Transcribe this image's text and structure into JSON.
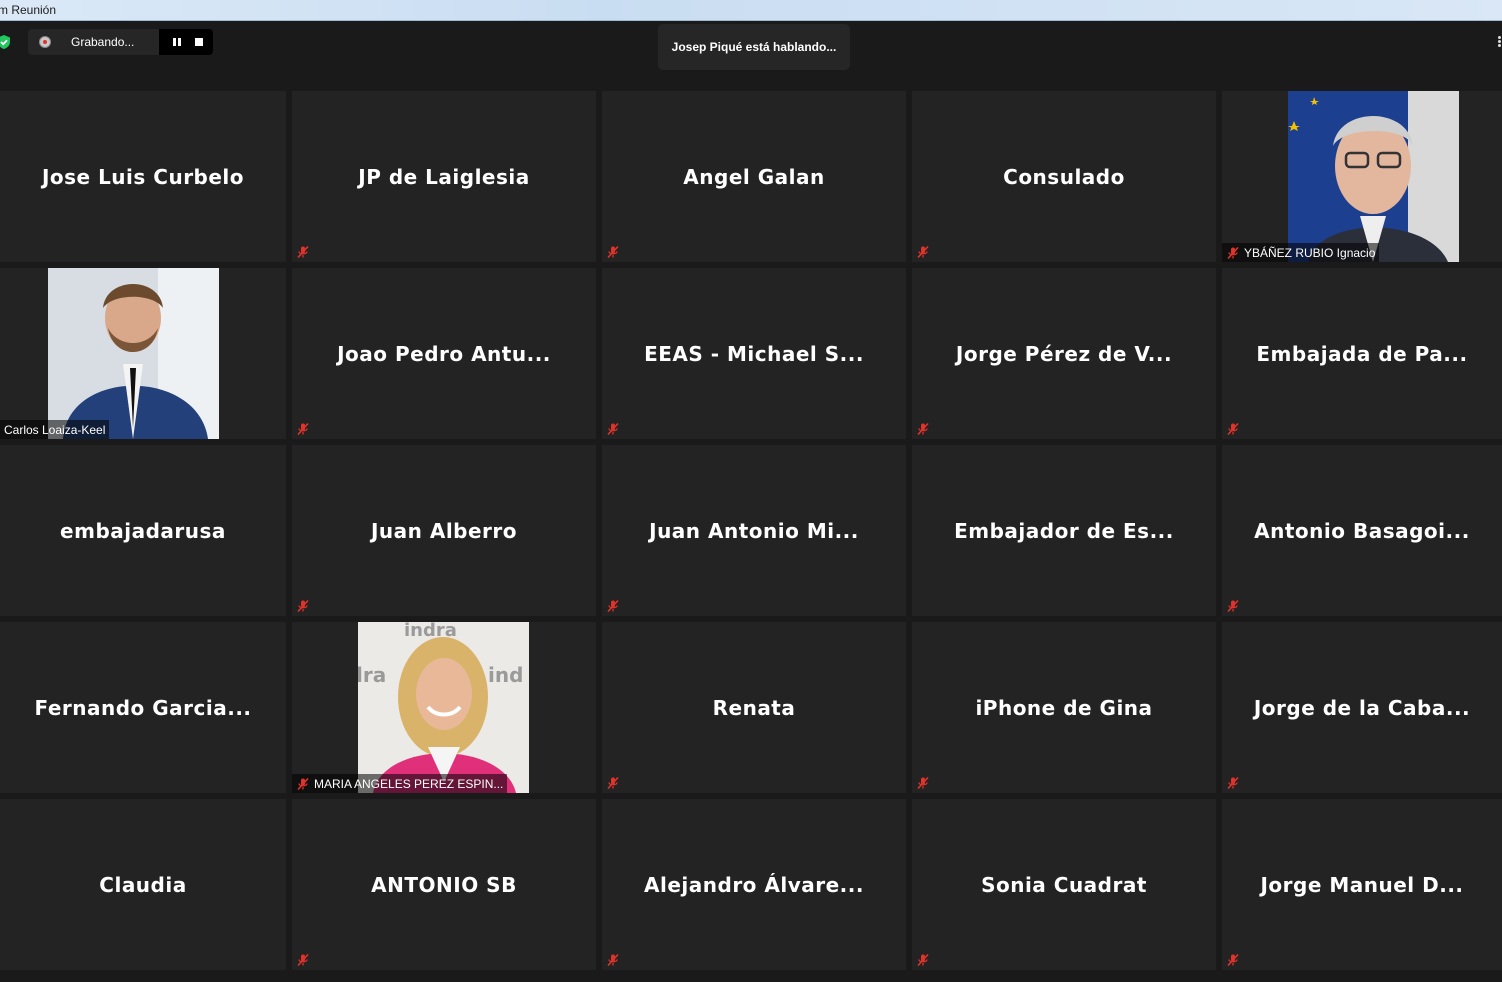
{
  "window": {
    "title": "m Reunión"
  },
  "recording": {
    "label": "Grabando..."
  },
  "speaking_banner": "Josep Piqué está hablando...",
  "participants": [
    {
      "name": "Jose Luis Curbelo",
      "muted": false
    },
    {
      "name": "JP de Laiglesia",
      "muted": true
    },
    {
      "name": "Angel Galan",
      "muted": true
    },
    {
      "name": "Consulado",
      "muted": true
    },
    {
      "name": "YBÁÑEZ RUBIO Ignacio",
      "muted": true,
      "video": true
    },
    {
      "name": "Carlos Loaiza-Keel",
      "muted": false,
      "video": true
    },
    {
      "name": "Joao Pedro Antu...",
      "muted": true
    },
    {
      "name": "EEAS - Michael S...",
      "muted": true
    },
    {
      "name": "Jorge Pérez de V...",
      "muted": true
    },
    {
      "name": "Embajada de Pa...",
      "muted": true
    },
    {
      "name": "embajadarusa",
      "muted": false
    },
    {
      "name": "Juan Alberro",
      "muted": true
    },
    {
      "name": "Juan Antonio Mi...",
      "muted": true
    },
    {
      "name": "Embajador de Es...",
      "muted": false
    },
    {
      "name": "Antonio Basagoi...",
      "muted": true
    },
    {
      "name": "Fernando Garcia...",
      "muted": false
    },
    {
      "name": "MARIA ANGELES PEREZ ESPIN...",
      "muted": true,
      "video": true
    },
    {
      "name": "Renata",
      "muted": true
    },
    {
      "name": "iPhone de Gina",
      "muted": true
    },
    {
      "name": "Jorge de la Caba...",
      "muted": true
    },
    {
      "name": "Claudia",
      "muted": false
    },
    {
      "name": "ANTONIO SB",
      "muted": true
    },
    {
      "name": "Alejandro Álvare...",
      "muted": true
    },
    {
      "name": "Sonia Cuadrat",
      "muted": true
    },
    {
      "name": "Jorge Manuel D...",
      "muted": true
    }
  ],
  "photo_logo_text": {
    "top": "indra",
    "left": "lra",
    "right": "ind"
  },
  "colors": {
    "tile_bg": "#232323",
    "mute_red": "#e0332b",
    "shield_green": "#22c55e"
  }
}
